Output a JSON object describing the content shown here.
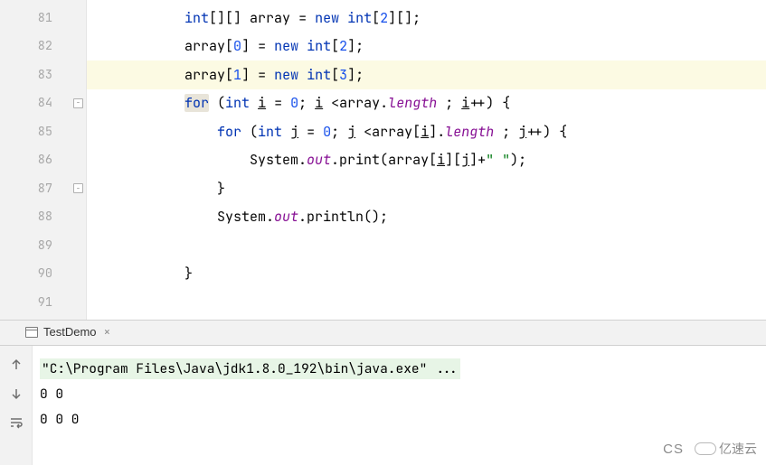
{
  "gutter": {
    "lines": [
      {
        "n": "81",
        "fold": null
      },
      {
        "n": "82",
        "fold": null
      },
      {
        "n": "83",
        "fold": null
      },
      {
        "n": "84",
        "fold": "open"
      },
      {
        "n": "85",
        "fold": null
      },
      {
        "n": "86",
        "fold": null
      },
      {
        "n": "87",
        "fold": "close"
      },
      {
        "n": "88",
        "fold": null
      },
      {
        "n": "89",
        "fold": null
      },
      {
        "n": "90",
        "fold": null
      },
      {
        "n": "91",
        "fold": null
      }
    ]
  },
  "code": {
    "indent": {
      "l81": "            ",
      "l82": "            ",
      "l83": "            ",
      "l84": "            ",
      "l85": "                ",
      "l86": "                    ",
      "l87": "                ",
      "l88": "                ",
      "l89": "",
      "l90": "            ",
      "l91": ""
    },
    "l81": {
      "kw1": "int",
      "brackets": "[][] ",
      "id": "array",
      "eq": " = ",
      "kw2": "new int",
      "open": "[",
      "num": "2",
      "close": "][];"
    },
    "l82": {
      "id": "array",
      "open": "[",
      "num0": "0",
      "mid": "] = ",
      "kw": "new int",
      "open2": "[",
      "num2": "2",
      "end": "];"
    },
    "l83": {
      "id": "array",
      "open": "[",
      "num0": "1",
      "mid": "] = ",
      "kw": "new int",
      "open2": "[",
      "num2": "3",
      "end": "];"
    },
    "l84": {
      "kw": "for",
      "open": " (",
      "kw2": "int",
      "sp": " ",
      "i": "i",
      "eq": " = ",
      "num": "0",
      "semi": "; ",
      "i2": "i",
      "cmp": " <",
      "arr": "array.",
      "len": "length",
      "sp2": " ; ",
      "i3": "i",
      "inc": "++) {"
    },
    "l85": {
      "kw": "for",
      "open": " (",
      "kw2": "int",
      "sp": " ",
      "j": "j",
      "eq": " = ",
      "num": "0",
      "semi": "; ",
      "j2": "j",
      "cmp": " <",
      "arr": "array[",
      "i": "i",
      "br": "].",
      "len": "length",
      "sp2": " ; ",
      "j3": "j",
      "inc": "++) {"
    },
    "l86": {
      "sys": "System.",
      "out": "out",
      "print": ".print(",
      "arr": "array[",
      "i": "i",
      "mid": "][",
      "j": "j",
      "close": "]+",
      "str": "\" \"",
      "end": ");"
    },
    "l87": {
      "brace": "}"
    },
    "l88": {
      "sys": "System.",
      "out": "out",
      "print": ".println();"
    },
    "l90": {
      "brace": "}"
    }
  },
  "console": {
    "tab_label": "TestDemo",
    "tab_close": "×",
    "cmd": "\"C:\\Program Files\\Java\\jdk1.8.0_192\\bin\\java.exe\" ...",
    "out1": "0 0",
    "out2": "0 0 0"
  },
  "watermark": {
    "cs": "CS",
    "brand": "亿速云"
  }
}
